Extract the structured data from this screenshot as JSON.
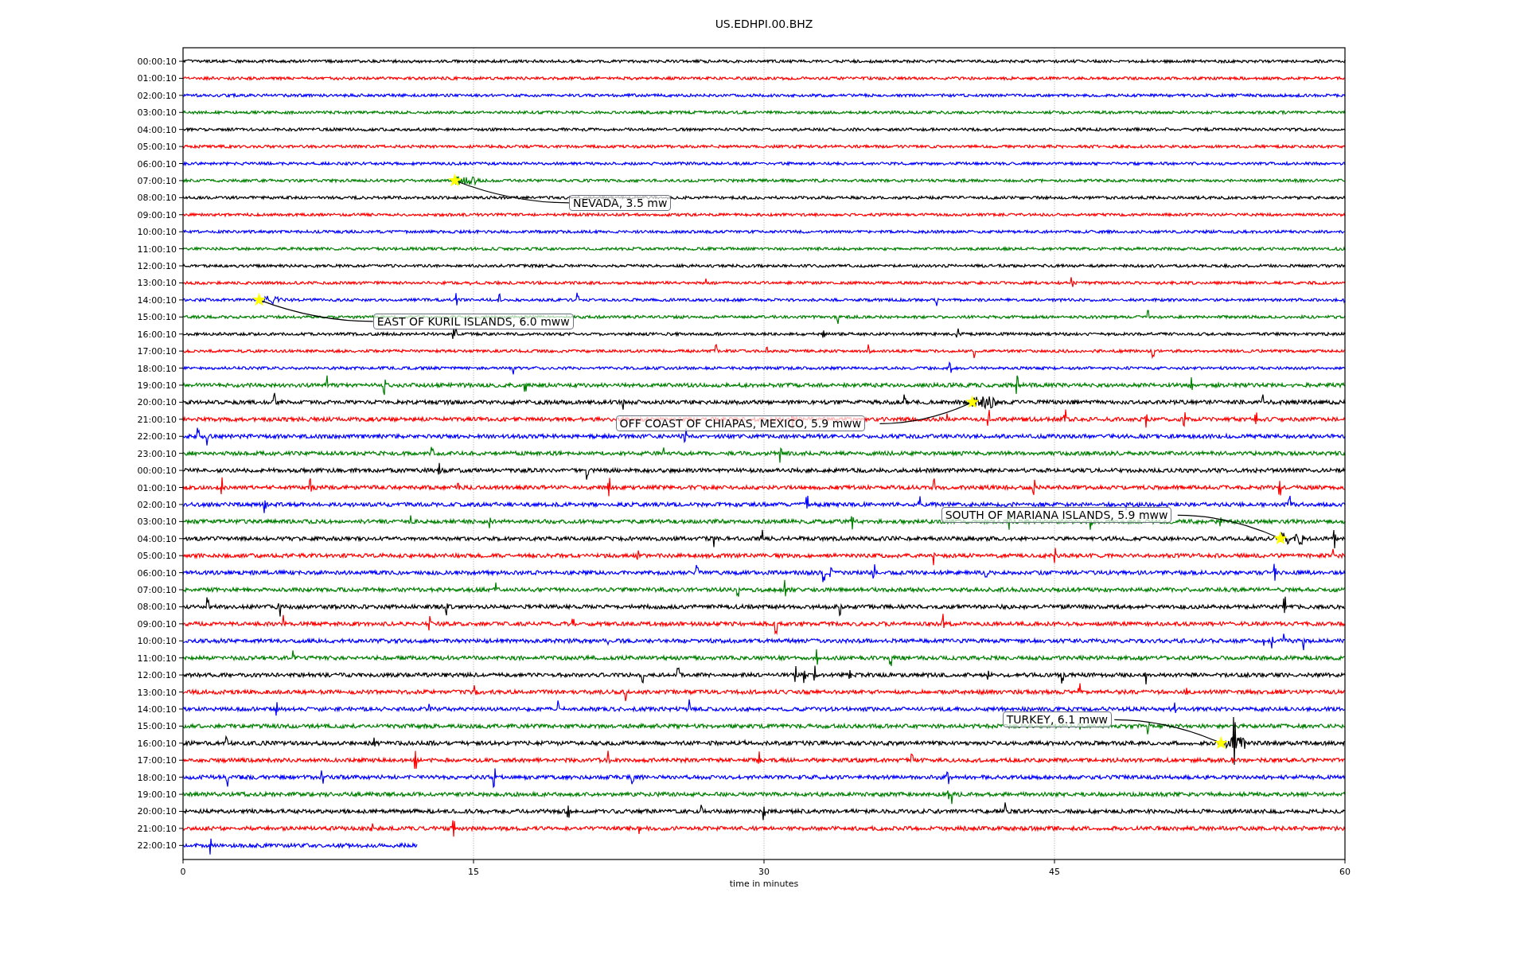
{
  "figure": {
    "title": "US.EDHPI.00.BHZ",
    "xlabel": "time in minutes",
    "xtick_labels": [
      "0",
      "15",
      "30",
      "45",
      "60"
    ],
    "rows": [
      {
        "label": "00:00:10",
        "color": "#000000"
      },
      {
        "label": "01:00:10",
        "color": "#ff0000"
      },
      {
        "label": "02:00:10",
        "color": "#0000ff"
      },
      {
        "label": "03:00:10",
        "color": "#008000"
      },
      {
        "label": "04:00:10",
        "color": "#000000"
      },
      {
        "label": "05:00:10",
        "color": "#ff0000"
      },
      {
        "label": "06:00:10",
        "color": "#0000ff"
      },
      {
        "label": "07:00:10",
        "color": "#008000"
      },
      {
        "label": "08:00:10",
        "color": "#000000"
      },
      {
        "label": "09:00:10",
        "color": "#ff0000"
      },
      {
        "label": "10:00:10",
        "color": "#0000ff"
      },
      {
        "label": "11:00:10",
        "color": "#008000"
      },
      {
        "label": "12:00:10",
        "color": "#000000"
      },
      {
        "label": "13:00:10",
        "color": "#ff0000"
      },
      {
        "label": "14:00:10",
        "color": "#0000ff"
      },
      {
        "label": "15:00:10",
        "color": "#008000"
      },
      {
        "label": "16:00:10",
        "color": "#000000"
      },
      {
        "label": "17:00:10",
        "color": "#ff0000"
      },
      {
        "label": "18:00:10",
        "color": "#0000ff"
      },
      {
        "label": "19:00:10",
        "color": "#008000"
      },
      {
        "label": "20:00:10",
        "color": "#000000"
      },
      {
        "label": "21:00:10",
        "color": "#ff0000"
      },
      {
        "label": "22:00:10",
        "color": "#0000ff"
      },
      {
        "label": "23:00:10",
        "color": "#008000"
      },
      {
        "label": "00:00:10",
        "color": "#000000"
      },
      {
        "label": "01:00:10",
        "color": "#ff0000"
      },
      {
        "label": "02:00:10",
        "color": "#0000ff"
      },
      {
        "label": "03:00:10",
        "color": "#008000"
      },
      {
        "label": "04:00:10",
        "color": "#000000"
      },
      {
        "label": "05:00:10",
        "color": "#ff0000"
      },
      {
        "label": "06:00:10",
        "color": "#0000ff"
      },
      {
        "label": "07:00:10",
        "color": "#008000"
      },
      {
        "label": "08:00:10",
        "color": "#000000"
      },
      {
        "label": "09:00:10",
        "color": "#ff0000"
      },
      {
        "label": "10:00:10",
        "color": "#0000ff"
      },
      {
        "label": "11:00:10",
        "color": "#008000"
      },
      {
        "label": "12:00:10",
        "color": "#000000"
      },
      {
        "label": "13:00:10",
        "color": "#ff0000"
      },
      {
        "label": "14:00:10",
        "color": "#0000ff"
      },
      {
        "label": "15:00:10",
        "color": "#008000"
      },
      {
        "label": "16:00:10",
        "color": "#000000"
      },
      {
        "label": "17:00:10",
        "color": "#ff0000"
      },
      {
        "label": "18:00:10",
        "color": "#0000ff"
      },
      {
        "label": "19:00:10",
        "color": "#008000"
      },
      {
        "label": "20:00:10",
        "color": "#000000"
      },
      {
        "label": "21:00:10",
        "color": "#ff0000"
      },
      {
        "label": "22:00:10",
        "color": "#0000ff"
      }
    ],
    "annotations": [
      {
        "text": "NEVADA, 3.5 mw"
      },
      {
        "text": "EAST OF KURIL ISLANDS, 6.0 mww"
      },
      {
        "text": "OFF COAST OF CHIAPAS, MEXICO, 5.9 mww"
      },
      {
        "text": "SOUTH OF MARIANA ISLANDS, 5.9 mww"
      },
      {
        "text": "TURKEY, 6.1 mww"
      }
    ]
  }
}
